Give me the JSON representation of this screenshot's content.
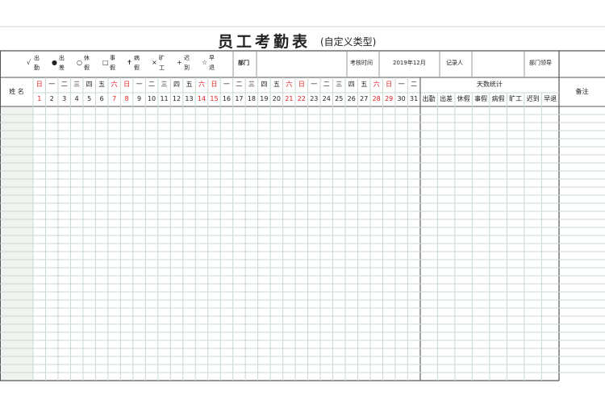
{
  "title": {
    "main": "员工考勤表",
    "sub": "(自定义类型)"
  },
  "legend": [
    {
      "symbol": "√",
      "label": "出\n勤"
    },
    {
      "symbol": "●",
      "label": "出\n差"
    },
    {
      "symbol": "○",
      "label": "休\n假"
    },
    {
      "symbol": "□",
      "label": "事\n假"
    },
    {
      "symbol": "✝",
      "label": "病\n假"
    },
    {
      "symbol": "×",
      "label": "旷\n工"
    },
    {
      "symbol": "+",
      "label": "迟\n到"
    },
    {
      "symbol": "☆",
      "label": "早\n退"
    }
  ],
  "info": {
    "dept_label": "部门",
    "period_label": "考核时间",
    "period_value": "2019年12月",
    "recorder_label": "记录人",
    "leader_label": "部门领导"
  },
  "name_header": "姓 名",
  "weekdays": [
    "日",
    "一",
    "二",
    "三",
    "四",
    "五",
    "六",
    "日",
    "一",
    "二",
    "三",
    "四",
    "五",
    "六",
    "日",
    "一",
    "二",
    "三",
    "四",
    "五",
    "六",
    "日",
    "一",
    "二",
    "三",
    "四",
    "五",
    "六",
    "日",
    "一",
    "二"
  ],
  "days": [
    "1",
    "2",
    "3",
    "4",
    "5",
    "6",
    "7",
    "8",
    "9",
    "10",
    "11",
    "12",
    "13",
    "14",
    "15",
    "16",
    "17",
    "18",
    "19",
    "20",
    "21",
    "22",
    "23",
    "24",
    "25",
    "26",
    "27",
    "28",
    "29",
    "30",
    "31"
  ],
  "weekend_indices": [
    0,
    6,
    7,
    13,
    14,
    20,
    21,
    27,
    28
  ],
  "stats_header": "天数统计",
  "stats_columns": [
    "出勤",
    "出差",
    "休假",
    "事假",
    "病假",
    "旷工",
    "迟到",
    "早退"
  ],
  "remark_header": "备注",
  "colors": {
    "grid": "#c8d8d0",
    "border": "#555555",
    "weekend": "#e02020",
    "name_col": "#eef3ef"
  }
}
